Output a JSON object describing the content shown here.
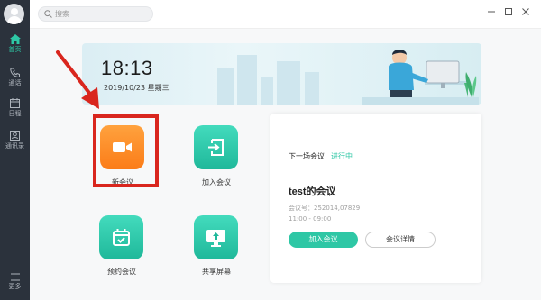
{
  "search": {
    "placeholder": "搜索"
  },
  "sidebar": {
    "items": [
      {
        "label": "首页",
        "icon": "home-icon"
      },
      {
        "label": "通话",
        "icon": "phone-icon"
      },
      {
        "label": "日程",
        "icon": "calendar-icon"
      },
      {
        "label": "通讯录",
        "icon": "contacts-icon"
      },
      {
        "label": "更多",
        "icon": "more-icon"
      }
    ],
    "active_color": "#2ec7a5"
  },
  "banner": {
    "time": "18:13",
    "date": "2019/10/23 星期三"
  },
  "actions": [
    {
      "label": "新会议",
      "icon": "video-camera-icon",
      "color": "#fb8a22"
    },
    {
      "label": "加入会议",
      "icon": "join-meeting-icon",
      "color": "#2ec7a5"
    },
    {
      "label": "预约会议",
      "icon": "calendar-check-icon",
      "color": "#2ec7a5"
    },
    {
      "label": "共享屏幕",
      "icon": "share-screen-icon",
      "color": "#2ec7a5"
    }
  ],
  "next_meeting": {
    "header": "下一场会议",
    "status": "进行中",
    "title": "test的会议",
    "meeting_id": "会议号：252014,07829",
    "time_range": "11:00 - 09:00",
    "join_label": "加入会议",
    "detail_label": "会议详情"
  },
  "annotation": {
    "highlight_color": "#d9261e"
  }
}
